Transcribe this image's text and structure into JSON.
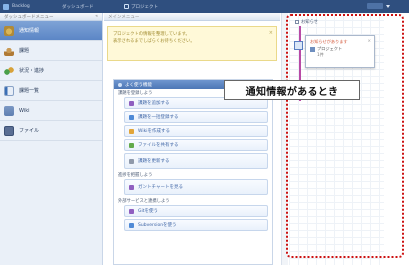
{
  "header": {
    "brand": "Backlog",
    "nav_label": "ダッシュボード",
    "middle_label": "プロジェクト",
    "user_label": "ログアウト"
  },
  "sidebar": {
    "title": "ダッシュボードメニュー",
    "collapse_glyph": "«",
    "items": [
      {
        "label": "通知情報",
        "icon": "bell-icon",
        "active": true
      },
      {
        "label": "課題",
        "icon": "user-icon",
        "active": false
      },
      {
        "label": "状況・進捗",
        "icon": "chart-icon",
        "active": false
      },
      {
        "label": "課題一覧",
        "icon": "list-icon",
        "active": false
      },
      {
        "label": "Wiki",
        "icon": "doc-icon",
        "active": false
      },
      {
        "label": "ファイル",
        "icon": "file-icon",
        "active": false
      }
    ]
  },
  "main": {
    "header": "メインメニュー",
    "notice": {
      "line1": "プロジェクトの情報を整理しています。",
      "line2": "表示されるまでしばらくお待ちください。",
      "close_glyph": "×"
    },
    "tasks": {
      "title": "よく使う機能",
      "sections": [
        {
          "label": "課題を登録しよう",
          "items": [
            {
              "label": "課題を追加する",
              "color": "purple"
            },
            {
              "label": "課題を一括登録する",
              "color": "blue"
            },
            {
              "label": "Wikiを作成する",
              "color": "pencil"
            },
            {
              "label": "ファイルを共有する",
              "color": "green"
            },
            {
              "label": "課題を更新する",
              "sub": "課題の状態・担当者などを変更します。",
              "color": "gray",
              "tall": true
            }
          ]
        },
        {
          "label": "進捗を把握しよう",
          "items": [
            {
              "label": "ガントチャートを見る",
              "sub": "期限日・進捗をグラフで確認します。",
              "color": "purple",
              "tall": true
            }
          ]
        },
        {
          "label": "外部サービスと連携しよう",
          "items": [
            {
              "label": "Gitを使う",
              "color": "purple"
            },
            {
              "label": "Subversionを使う",
              "color": "blue"
            }
          ]
        }
      ]
    }
  },
  "right_panel": {
    "title": "お知らせ",
    "popup": {
      "title": "お知らせがあります",
      "close_glyph": "×",
      "name": "プロジェクト",
      "count": "1件"
    }
  },
  "callout": {
    "text": "通知情報があるとき"
  },
  "colors": {
    "header_bg": "#2f4f7f",
    "highlight": "#cc1111",
    "sidebar_active": "#5b86c6",
    "task_text": "#3d64a5"
  }
}
